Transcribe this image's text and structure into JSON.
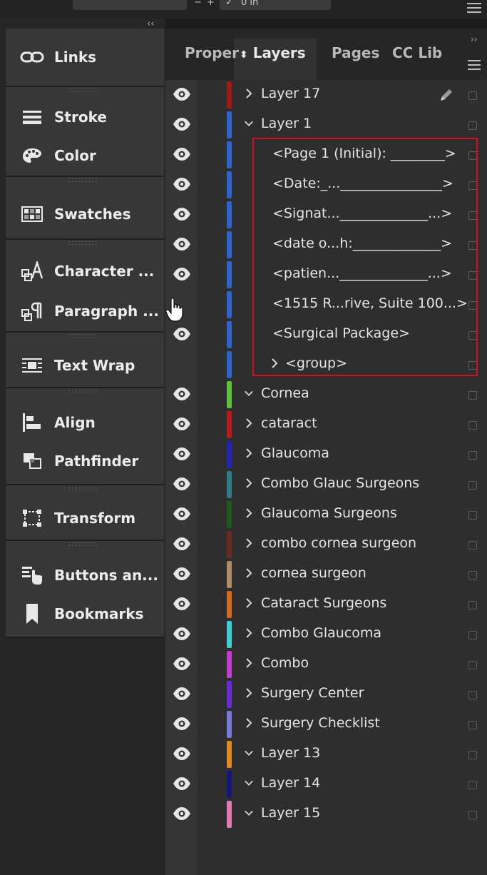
{
  "top_bar": {
    "minus": "−",
    "plus": "+",
    "check": "✓",
    "value": "0 in"
  },
  "left_dock": {
    "collapse_label": "‹‹",
    "groups": [
      {
        "items": [
          {
            "label": "Links",
            "icon": "links-icon"
          }
        ]
      },
      {
        "items": [
          {
            "label": "Stroke",
            "icon": "stroke-icon"
          },
          {
            "label": "Color",
            "icon": "color-palette-icon"
          }
        ]
      },
      {
        "items": [
          {
            "label": "Swatches",
            "icon": "swatches-icon"
          }
        ]
      },
      {
        "items": [
          {
            "label": "Character ...",
            "icon": "character-icon"
          },
          {
            "label": "Paragraph ...",
            "icon": "paragraph-icon"
          }
        ]
      },
      {
        "items": [
          {
            "label": "Text Wrap",
            "icon": "text-wrap-icon"
          }
        ]
      },
      {
        "items": [
          {
            "label": "Align",
            "icon": "align-icon"
          },
          {
            "label": "Pathfinder",
            "icon": "pathfinder-icon"
          }
        ]
      },
      {
        "items": [
          {
            "label": "Transform",
            "icon": "transform-icon"
          }
        ]
      },
      {
        "items": [
          {
            "label": "Buttons an...",
            "icon": "buttons-icon"
          },
          {
            "label": "Bookmarks",
            "icon": "bookmark-icon"
          }
        ]
      }
    ]
  },
  "layers_panel": {
    "tabs": [
      "Proper",
      "Layers",
      "Pages",
      "CC Lib"
    ],
    "active_tab": "Layers",
    "rows": [
      {
        "label": "Layer 17",
        "color": "#a01a14",
        "twisty": "right",
        "indent": 0,
        "eye": true,
        "pencil": true
      },
      {
        "label": "Layer 1",
        "color": "#2f62cc",
        "twisty": "down",
        "indent": 0,
        "eye": true
      },
      {
        "label": "<Page 1 (Initial): ________>",
        "color": "#2f62cc",
        "twisty": "",
        "indent": 1,
        "eye": true
      },
      {
        "label": "<Date:_..._______________>",
        "color": "#2f62cc",
        "twisty": "",
        "indent": 1,
        "eye": true
      },
      {
        "label": "<Signat..._____________...>",
        "color": "#2f62cc",
        "twisty": "",
        "indent": 1,
        "eye": true
      },
      {
        "label": "<date o...h:_____________>",
        "color": "#2f62cc",
        "twisty": "",
        "indent": 1,
        "eye": true
      },
      {
        "label": "<patien..._____________...>",
        "color": "#2f62cc",
        "twisty": "",
        "indent": 1,
        "eye": true
      },
      {
        "label": "<1515 R...rive, Suite 100...>",
        "color": "#2f62cc",
        "twisty": "",
        "indent": 1,
        "eye": false
      },
      {
        "label": "<Surgical Package>",
        "color": "#2f62cc",
        "twisty": "",
        "indent": 1,
        "eye": true
      },
      {
        "label": "<group>",
        "color": "#2f62cc",
        "twisty": "right",
        "indent": 1,
        "eye": false
      },
      {
        "label": "Cornea",
        "color": "#5cc23a",
        "twisty": "down",
        "indent": 0,
        "eye": true
      },
      {
        "label": "cataract",
        "color": "#b81b1b",
        "twisty": "right",
        "indent": 0,
        "eye": true
      },
      {
        "label": "Glaucoma",
        "color": "#2323b8",
        "twisty": "right",
        "indent": 0,
        "eye": true
      },
      {
        "label": "Combo Glauc Surgeons",
        "color": "#2e7d86",
        "twisty": "right",
        "indent": 0,
        "eye": true
      },
      {
        "label": "Glaucoma Surgeons",
        "color": "#1e5a1e",
        "twisty": "right",
        "indent": 0,
        "eye": true
      },
      {
        "label": "combo cornea surgeon",
        "color": "#6a2a22",
        "twisty": "right",
        "indent": 0,
        "eye": true
      },
      {
        "label": "cornea surgeon",
        "color": "#b08a62",
        "twisty": "right",
        "indent": 0,
        "eye": true
      },
      {
        "label": "Cataract Surgeons",
        "color": "#d66a1c",
        "twisty": "right",
        "indent": 0,
        "eye": true
      },
      {
        "label": "Combo Glaucoma",
        "color": "#3ed0d0",
        "twisty": "right",
        "indent": 0,
        "eye": true
      },
      {
        "label": "Combo",
        "color": "#c23ad0",
        "twisty": "right",
        "indent": 0,
        "eye": true
      },
      {
        "label": "Surgery Center",
        "color": "#6a2ad6",
        "twisty": "right",
        "indent": 0,
        "eye": true
      },
      {
        "label": "Surgery Checklist",
        "color": "#7a7ad6",
        "twisty": "right",
        "indent": 0,
        "eye": true
      },
      {
        "label": "Layer 13",
        "color": "#e08a1c",
        "twisty": "down",
        "indent": 0,
        "eye": true
      },
      {
        "label": "Layer 14",
        "color": "#15157a",
        "twisty": "down",
        "indent": 0,
        "eye": true
      },
      {
        "label": "Layer 15",
        "color": "#e07ab0",
        "twisty": "down",
        "indent": 0,
        "eye": true
      }
    ]
  }
}
